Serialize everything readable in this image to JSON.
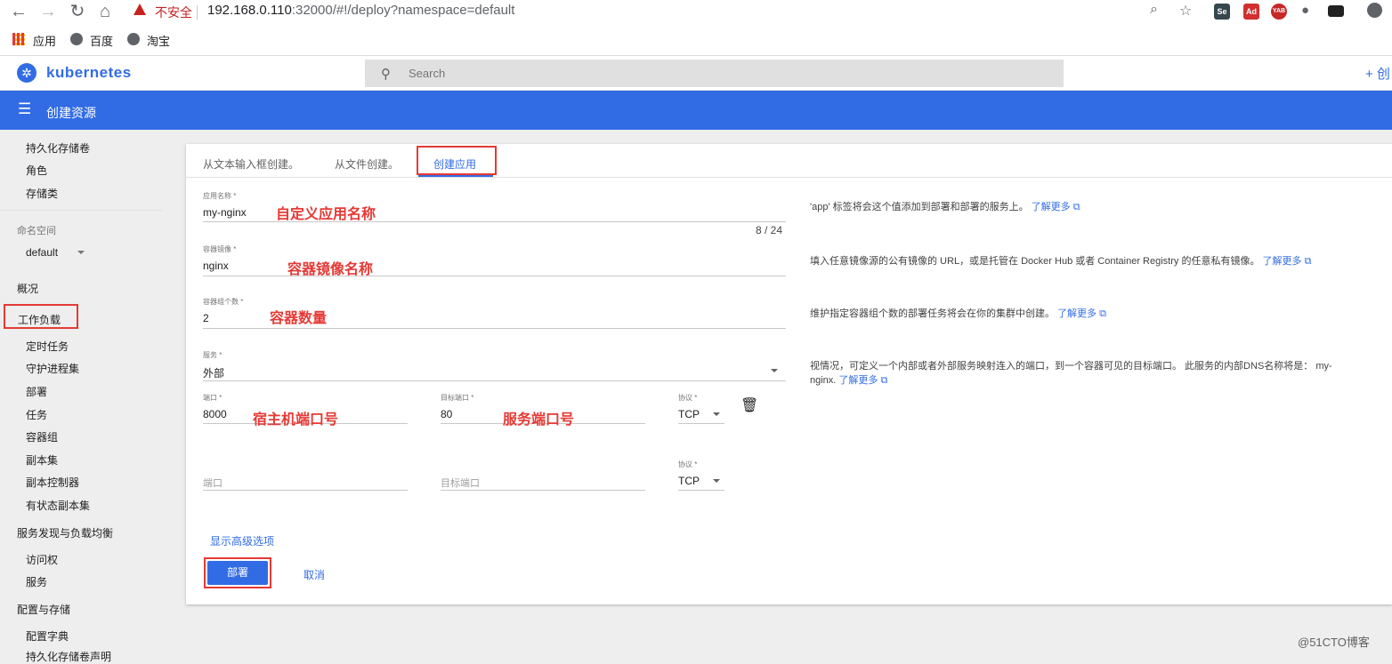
{
  "browser": {
    "security_label": "不安全",
    "url_host": "192.168.0.110",
    "url_rest": ":32000/#!/deploy?namespace=default",
    "bookmarks": [
      "应用",
      "百度",
      "淘宝"
    ],
    "extensions": [
      "Se",
      "Ad",
      "YAB"
    ]
  },
  "header": {
    "logo_glyph": "✲",
    "title": "kubernetes",
    "search_placeholder": "Search",
    "create_label": "+ 创"
  },
  "action_bar": {
    "title": "创建资源"
  },
  "sidebar": {
    "top_items": [
      "持久化存储卷",
      "角色",
      "存储类"
    ],
    "namespace_label": "命名空间",
    "namespace_value": "default",
    "overview": "概况",
    "workloads": "工作负载",
    "workload_items": [
      "定时任务",
      "守护进程集",
      "部署",
      "任务",
      "容器组",
      "副本集",
      "副本控制器",
      "有状态副本集"
    ],
    "discovery": "服务发现与负载均衡",
    "discovery_items": [
      "访问权",
      "服务"
    ],
    "config": "配置与存储",
    "config_items": [
      "配置字典",
      "持久化存储卷声明"
    ]
  },
  "tabs": [
    "从文本输入框创建。",
    "从文件创建。",
    "创建应用"
  ],
  "form": {
    "app_name": {
      "label": "应用名称 *",
      "value": "my-nginx",
      "counter": "8 / 24",
      "annotation": "自定义应用名称"
    },
    "image": {
      "label": "容器镜像 *",
      "value": "nginx",
      "annotation": "容器镜像名称"
    },
    "pods": {
      "label": "容器组个数 *",
      "value": "2",
      "annotation": "容器数量"
    },
    "service": {
      "label": "服务 *",
      "value": "外部"
    },
    "port1": {
      "label": "端口 *",
      "value": "8000",
      "annotation": "宿主机端口号"
    },
    "target1": {
      "label": "目标端口 *",
      "value": "80",
      "annotation": "服务端口号"
    },
    "protocol1": {
      "label": "协议 *",
      "value": "TCP"
    },
    "port2": {
      "placeholder": "端口"
    },
    "target2": {
      "placeholder": "目标端口"
    },
    "protocol2": {
      "label": "协议 *",
      "value": "TCP"
    },
    "advanced_link": "显示高级选项",
    "deploy_label": "部署",
    "cancel_label": "取消"
  },
  "help": {
    "app_name": {
      "text": "'app' 标签将会这个值添加到部署和部署的服务上。",
      "link": "了解更多"
    },
    "image": {
      "text": "填入任意镜像源的公有镜像的 URL，或是托管在 Docker Hub 或者 Container Registry 的任意私有镜像。",
      "link": "了解更多"
    },
    "pods": {
      "text": "维护指定容器组个数的部署任务将会在你的集群中创建。",
      "link": "了解更多"
    },
    "service_line1": "视情况，可定义一个内部或者外部服务映射连入的端口，到一个容器可见的目标端口。 此服务的内部DNS名称将是： my-",
    "service_line2": "nginx.",
    "service_link": "了解更多"
  },
  "watermark": "@51CTO博客",
  "colors": {
    "accent": "#326ce5",
    "annotation": "#e53935"
  }
}
